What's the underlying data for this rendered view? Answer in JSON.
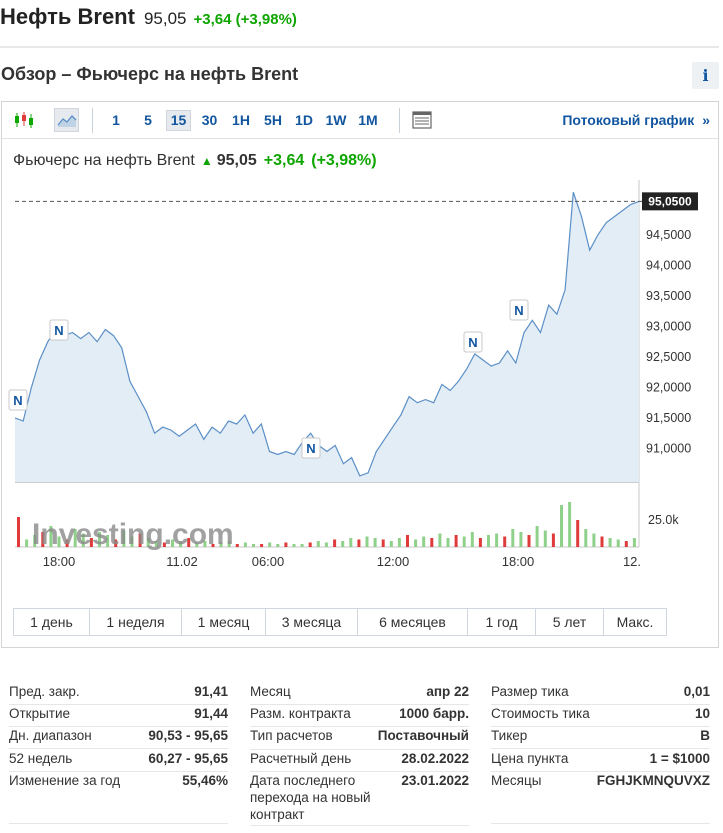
{
  "header": {
    "title": "Нефть Brent",
    "price": "95,05",
    "change": "+3,64 (+3,98%)"
  },
  "section": {
    "title": "Обзор – Фьючерс на нефть Brent",
    "info_icon": "info-icon"
  },
  "toolbar": {
    "chart_type_icons": [
      "candlestick-icon",
      "area-chart-icon"
    ],
    "intervals": [
      "1",
      "5",
      "15",
      "30",
      "1H",
      "5H",
      "1D",
      "1W",
      "1M"
    ],
    "active_interval": "15",
    "table_icon": "table-icon",
    "streaming_link": "Потоковый график",
    "streaming_arrow": "»"
  },
  "chart_header": {
    "name": "Фьючерс на нефть Brent",
    "arrow": "▲",
    "price": "95,05",
    "change": "+3,64",
    "change_pct": "(+3,98%)"
  },
  "chart_data": {
    "type": "area",
    "x_labels": [
      "18:00",
      "11.02",
      "06:00",
      "12:00",
      "18:00",
      "12."
    ],
    "y_ticks": [
      "94,5000",
      "94,0000",
      "93,5000",
      "93,0000",
      "92,5000",
      "92,0000",
      "91,5000",
      "91,0000"
    ],
    "current_label": "95,0500",
    "current_value": 95.05,
    "ylim": [
      90.45,
      95.4
    ],
    "volume_tick": "25.0k",
    "watermark": "Investing.com",
    "news_markers": [
      "N",
      "N",
      "N",
      "N",
      "N"
    ],
    "series": [
      {
        "values": [
          91.5,
          91.45,
          92.0,
          92.45,
          92.75,
          92.95,
          92.85,
          92.9,
          92.8,
          92.9,
          92.75,
          92.95,
          92.85,
          92.65,
          92.1,
          91.85,
          91.6,
          91.25,
          91.35,
          91.3,
          91.2,
          91.3,
          91.4,
          91.15,
          91.35,
          91.25,
          91.45,
          91.4,
          91.55,
          91.25,
          91.4,
          90.95,
          90.9,
          90.95,
          90.9,
          91.1,
          91.25,
          91.05,
          90.95,
          91.05,
          90.75,
          90.85,
          90.55,
          90.6,
          90.95,
          91.15,
          91.35,
          91.55,
          91.85,
          91.75,
          91.8,
          91.75,
          92.05,
          91.95,
          92.1,
          92.3,
          92.55,
          92.45,
          92.35,
          92.4,
          92.6,
          92.4,
          92.9,
          93.1,
          92.9,
          93.35,
          93.2,
          93.6,
          95.2,
          94.8,
          94.25,
          94.5,
          94.7,
          94.8,
          94.9,
          95.0,
          95.05
        ]
      }
    ],
    "volumes": [
      20,
      5,
      8,
      10,
      14,
      7,
      5,
      12,
      9,
      6,
      10,
      8,
      5,
      11,
      7,
      9,
      6,
      4,
      3,
      5,
      4,
      6,
      3,
      4,
      2,
      3,
      4,
      2,
      3,
      2,
      2,
      3,
      2,
      3,
      2,
      2,
      3,
      4,
      3,
      5,
      4,
      6,
      5,
      7,
      6,
      5,
      4,
      6,
      8,
      5,
      7,
      6,
      9,
      6,
      8,
      7,
      10,
      6,
      8,
      9,
      7,
      12,
      10,
      8,
      14,
      11,
      9,
      28,
      30,
      18,
      12,
      9,
      7,
      6,
      5,
      4,
      6
    ],
    "volume_colors": [
      "red",
      "green"
    ]
  },
  "ranges": [
    "1 день",
    "1 неделя",
    "1 месяц",
    "3 месяца",
    "6 месяцев",
    "1 год",
    "5 лет",
    "Макс."
  ],
  "stats": {
    "col1": [
      {
        "label": "Пред. закр.",
        "value": "91,41"
      },
      {
        "label": "Открытие",
        "value": "91,44"
      },
      {
        "label": "Дн. диапазон",
        "value": "90,53 - 95,65"
      },
      {
        "label": "52 недель",
        "value": "60,27 - 95,65"
      },
      {
        "label": "Изменение за год",
        "value": "55,46%"
      }
    ],
    "col2": [
      {
        "label": "Месяц",
        "value": "апр 22"
      },
      {
        "label": "Разм. контракта",
        "value": "1000 барр."
      },
      {
        "label": "Тип расчетов",
        "value": "Поставочный"
      },
      {
        "label": "Расчетный день",
        "value": "28.02.2022"
      },
      {
        "label": "Дата последнего перехода на новый контракт",
        "value": "23.01.2022"
      }
    ],
    "col3": [
      {
        "label": "Размер тика",
        "value": "0,01"
      },
      {
        "label": "Стоимость тика",
        "value": "10"
      },
      {
        "label": "Тикер",
        "value": "B"
      },
      {
        "label": "Цена пункта",
        "value": "1 = $1000"
      },
      {
        "label": "Месяцы",
        "value": "FGHJKMNQUVXZ"
      }
    ]
  },
  "colors": {
    "green": "#0ea600",
    "red": "#e03b3b",
    "link": "#1256a0",
    "line": "#5b8fc7",
    "area": "#e3edf5"
  }
}
